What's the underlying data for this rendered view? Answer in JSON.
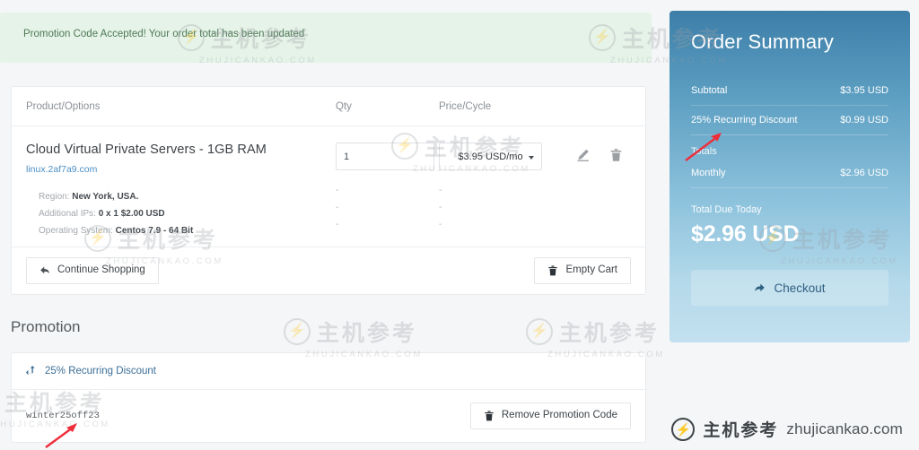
{
  "alert": {
    "message": "Promotion Code Accepted! Your order total has been updated"
  },
  "cart": {
    "headers": {
      "product": "Product/Options",
      "qty": "Qty",
      "price": "Price/Cycle"
    },
    "product": {
      "title": "Cloud Virtual Private Servers - 1GB RAM",
      "domain": "linux.2af7a9.com",
      "qty_value": "1",
      "cycle_value": "$3.95 USD/mo",
      "options": [
        {
          "label": "Region:",
          "value": "New York, USA."
        },
        {
          "label": "Additional IPs:",
          "value": "0 x 1 $2.00 USD"
        },
        {
          "label": "Operating System:",
          "value": "Centos 7.9 - 64 Bit"
        }
      ],
      "dash": "-"
    },
    "footer": {
      "continue_shopping": "Continue Shopping",
      "empty_cart": "Empty Cart"
    }
  },
  "promotion": {
    "heading": "Promotion",
    "applied_label": "25% Recurring Discount",
    "code": "winter25off23",
    "remove_label": "Remove Promotion Code"
  },
  "summary": {
    "title": "Order Summary",
    "rows": [
      {
        "label": "Subtotal",
        "value": "$3.95 USD"
      },
      {
        "label": "25% Recurring Discount",
        "value": "$0.99 USD"
      }
    ],
    "totals_label": "Totals",
    "monthly_label": "Monthly",
    "monthly_value": "$2.96 USD",
    "total_due_label": "Total Due Today",
    "total_due_value": "$2.96 USD",
    "checkout_label": "Checkout",
    "accent_top": "#3c7ea8",
    "accent_bottom": "#c3e0ef"
  },
  "watermark": {
    "cn": "主机参考",
    "sub": "ZHUJICANKAO.COM",
    "url": "zhujicankao.com"
  }
}
